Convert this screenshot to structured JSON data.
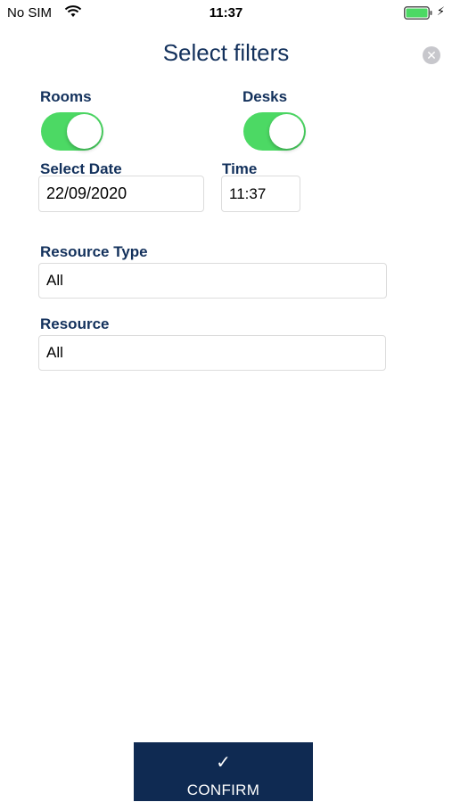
{
  "status_bar": {
    "carrier": "No SIM",
    "time": "11:37"
  },
  "header": {
    "title": "Select filters",
    "close_icon": "close-circle-icon"
  },
  "filters": {
    "rooms": {
      "label": "Rooms",
      "on": true
    },
    "desks": {
      "label": "Desks",
      "on": true
    },
    "date": {
      "label": "Select Date",
      "value": "22/09/2020"
    },
    "time": {
      "label": "Time",
      "value": "11:37"
    },
    "resource_type": {
      "label": "Resource Type",
      "value": "All"
    },
    "resource": {
      "label": "Resource",
      "value": "All"
    }
  },
  "footer": {
    "confirm_label": "CONFIRM",
    "confirm_icon": "checkmark-icon"
  },
  "colors": {
    "accent": "#13315c",
    "toggle_on": "#4cd964",
    "confirm_bg": "#0f2a52"
  }
}
